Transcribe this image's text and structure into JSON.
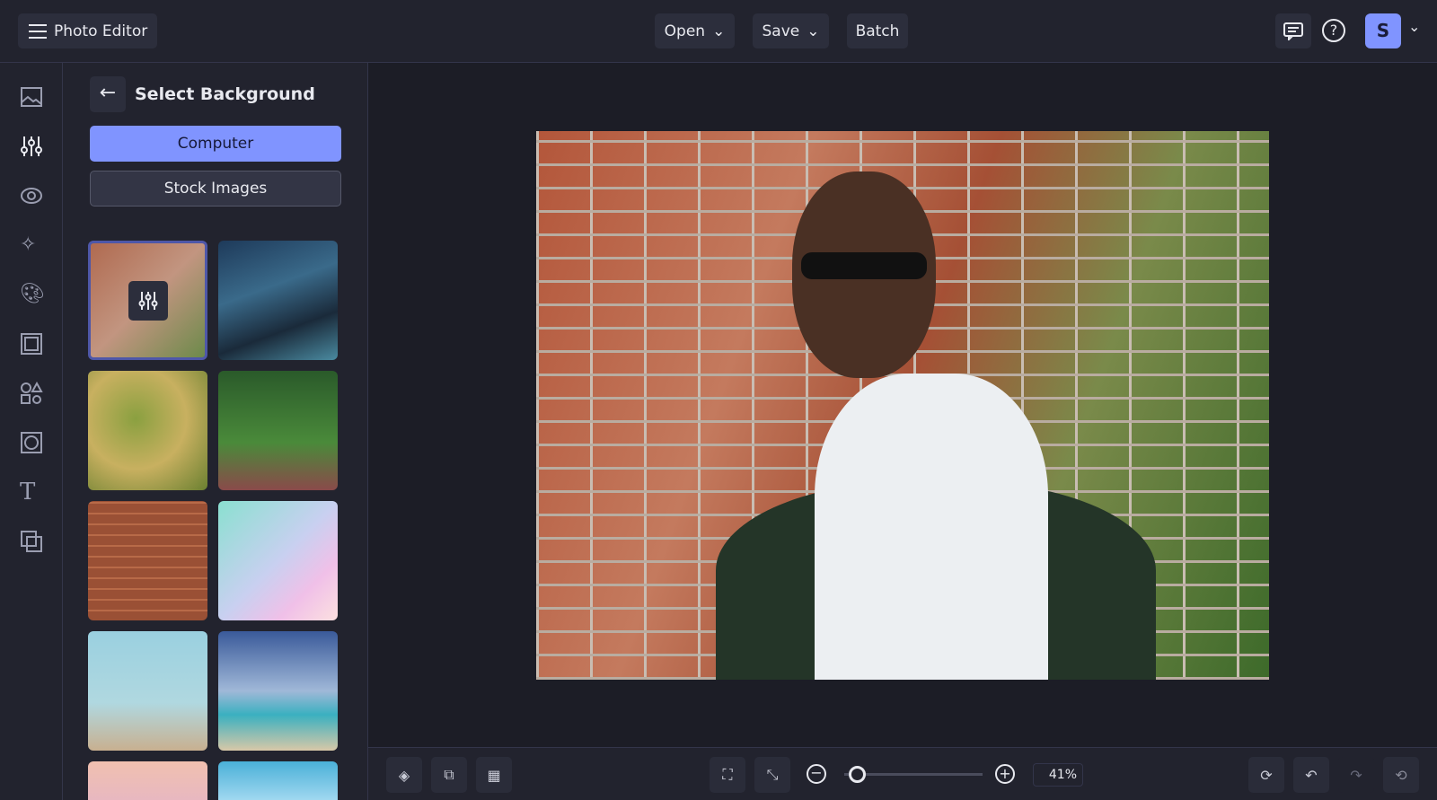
{
  "app": {
    "title": "Photo Editor"
  },
  "topbar": {
    "open_label": "Open",
    "save_label": "Save",
    "batch_label": "Batch",
    "avatar_initial": "S"
  },
  "panel": {
    "title": "Select Background",
    "computer_label": "Computer",
    "stock_label": "Stock Images"
  },
  "zoom": {
    "value": "41%",
    "slider_fraction": 0.1
  },
  "colors": {
    "accent": "#8094ff",
    "bg": "#1c1d26",
    "panel": "#22232e"
  }
}
